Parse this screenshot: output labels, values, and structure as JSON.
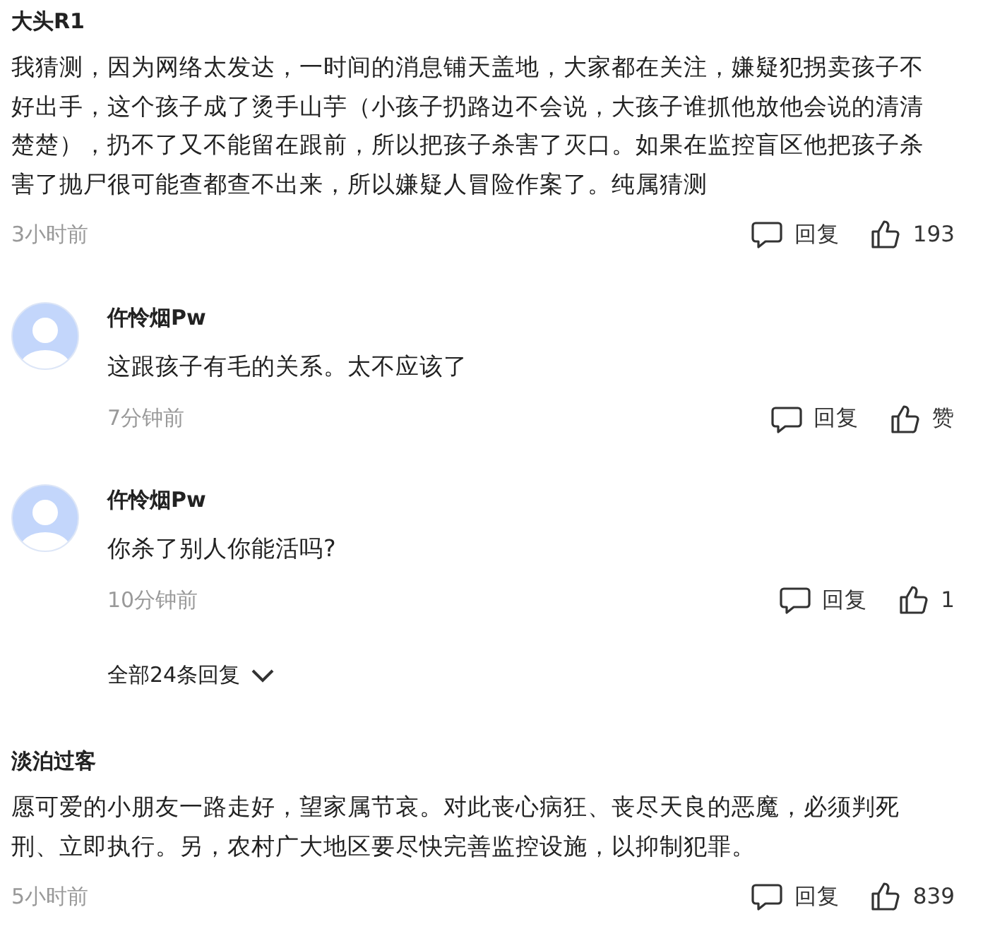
{
  "comments": [
    {
      "author": "大头R1",
      "text": "我猜测，因为网络太发达，一时间的消息铺天盖地，大家都在关注，嫌疑犯拐卖孩子不好出手，这个孩子成了烫手山芋（小孩子扔路边不会说，大孩子谁抓他放他会说的清清楚楚），扔不了又不能留在跟前，所以把孩子杀害了灭口。如果在监控盲区他把孩子杀害了抛尸很可能查都查不出来，所以嫌疑人冒险作案了。纯属猜测",
      "time": "3小时前",
      "reply_label": "回复",
      "likes": "193",
      "replies": [
        {
          "author": "仵怜烟Pw",
          "text": "这跟孩子有毛的关系。太不应该了",
          "time": "7分钟前",
          "reply_label": "回复",
          "likes": "赞"
        },
        {
          "author": "仵怜烟Pw",
          "text": "你杀了别人你能活吗?",
          "time": "10分钟前",
          "reply_label": "回复",
          "likes": "1"
        }
      ],
      "more_replies": "全部24条回复"
    },
    {
      "author": "淡泊过客",
      "text": "愿可爱的小朋友一路走好，望家属节哀。对此丧心病狂、丧尽天良的恶魔，必须判死刑、立即执行。另，农村广大地区要尽快完善监控设施，以抑制犯罪。",
      "time": "5小时前",
      "reply_label": "回复",
      "likes": "839"
    }
  ]
}
